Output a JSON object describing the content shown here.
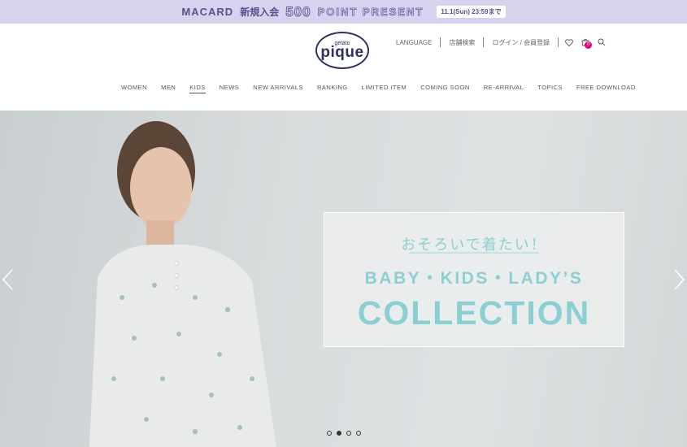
{
  "promo": {
    "brand": "MACARD",
    "jp_text": "新規入会",
    "points": "500",
    "present": "POINT PRESENT",
    "date": "11.1(Sun) 23:59まで"
  },
  "logo": {
    "small": "gelato",
    "big": "pique"
  },
  "utility": {
    "language": "LANGUAGE",
    "store_search": "店舗検索",
    "login": "ログイン / 会員登録",
    "cart_count": "0"
  },
  "nav": {
    "items": [
      "WOMEN",
      "MEN",
      "KIDS",
      "NEWS",
      "NEW ARRIVALS",
      "RANKING",
      "LIMITED ITEM",
      "COMING SOON",
      "RE-ARRIVAL",
      "TOPICS",
      "FREE DOWNLOAD"
    ],
    "active": "KIDS"
  },
  "hero": {
    "jp_title": "おそろいで着たい！",
    "subtitle": "BABY・KIDS・LADY’S",
    "title": "COLLECTION",
    "slide_count": 4,
    "active_slide": 2
  },
  "colors": {
    "promo_bg": "#d8d2ee",
    "accent_text": "#8ccfd3",
    "badge": "#e6007e",
    "logo": "#2c3161"
  },
  "icons": [
    "heart-icon",
    "cart-icon",
    "search-icon",
    "chevron-left-icon",
    "chevron-right-icon"
  ]
}
